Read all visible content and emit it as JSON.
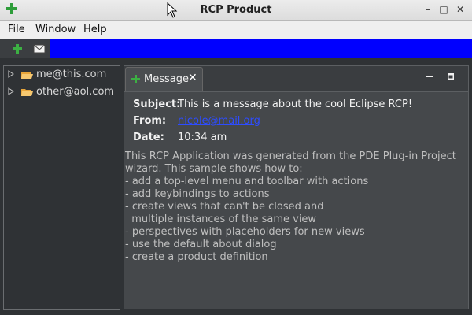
{
  "window": {
    "title": "RCP Product",
    "controls": {
      "minimize": "–",
      "maximize": "□",
      "close": "✕"
    }
  },
  "menubar": {
    "items": [
      "File",
      "Window",
      "Help"
    ]
  },
  "toolbar": {
    "buttons": [
      {
        "icon": "plus-icon"
      },
      {
        "icon": "mail-icon"
      }
    ],
    "accent": "#0000ff"
  },
  "navigation": {
    "accounts": [
      {
        "label": "me@this.com"
      },
      {
        "label": "other@aol.com"
      }
    ]
  },
  "message_view": {
    "tab": {
      "label": "Message",
      "close": "✕"
    },
    "subject_label": "Subject:",
    "subject": "This is a message about the cool Eclipse RCP!",
    "from_label": "From:",
    "from": "nicole@mail.org",
    "date_label": "Date:",
    "date": "10:34 am",
    "body": "This RCP Application was generated from the PDE Plug-in Project\nwizard. This sample shows how to:\n- add a top-level menu and toolbar with actions\n- add keybindings to actions\n- create views that can't be closed and\n  multiple instances of the same view\n- perspectives with placeholders for new views\n- use the default about dialog\n- create a product definition"
  },
  "colors": {
    "link": "#2d4cff",
    "plus_green": "#3cb043",
    "folder_orange": "#e8a53a"
  }
}
